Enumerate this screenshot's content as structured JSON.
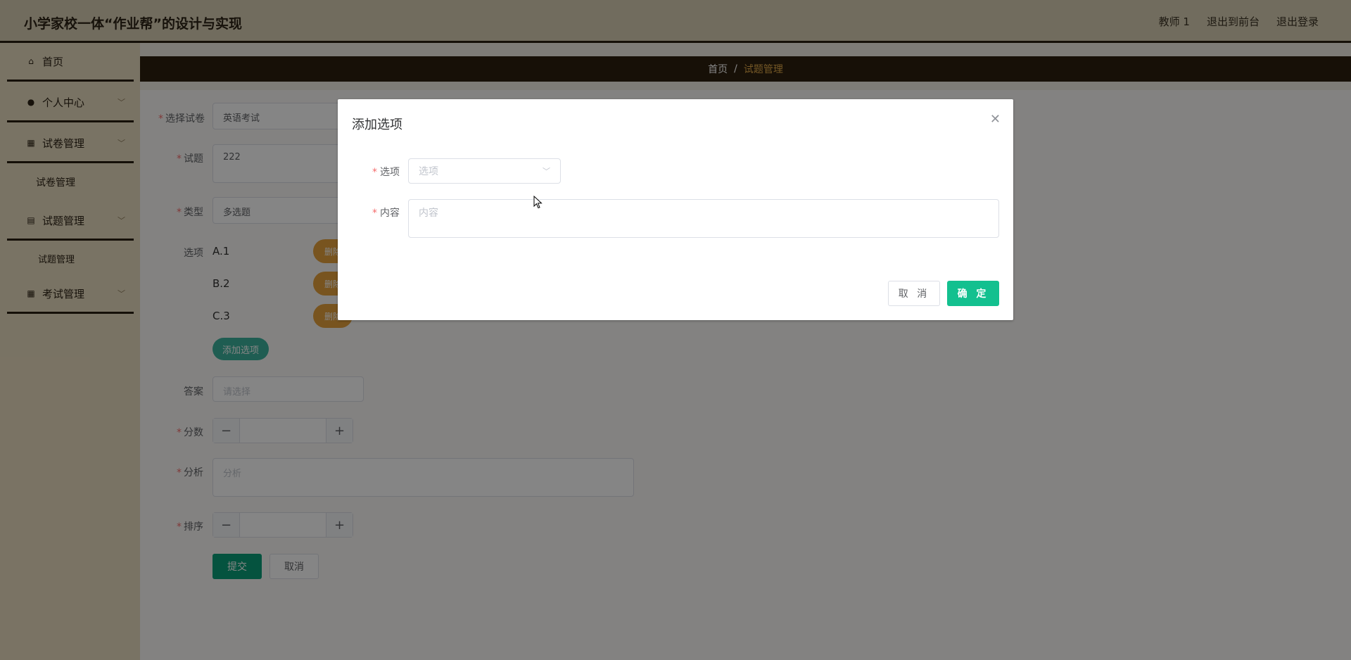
{
  "header": {
    "title": "小学家校一体“作业帮”的设计与实现",
    "links": [
      "教师 1",
      "退出到前台",
      "退出登录"
    ]
  },
  "sidebar": {
    "items": [
      {
        "label": "首页",
        "icon": "home-icon"
      },
      {
        "label": "个人中心",
        "icon": "user-icon"
      },
      {
        "label": "试卷管理",
        "icon": "grid-icon"
      },
      {
        "label": "试卷管理"
      },
      {
        "label": "试题管理",
        "icon": "clipboard-icon"
      },
      {
        "label": "试题管理"
      },
      {
        "label": "考试管理",
        "icon": "grid-icon"
      }
    ]
  },
  "breadcrumb": {
    "home": "首页",
    "separator": "/",
    "current": "试题管理"
  },
  "form": {
    "paper_label": "选择试卷",
    "paper_value": "英语考试",
    "question_label": "试题",
    "question_value": "222",
    "type_label": "类型",
    "type_value": "多选题",
    "options_label": "选项",
    "options": [
      "A.1",
      "B.2",
      "C.3"
    ],
    "delete_label": "删除",
    "add_option_label": "添加选项",
    "answer_label": "答案",
    "answer_placeholder": "请选择",
    "score_label": "分数",
    "analysis_label": "分析",
    "analysis_placeholder": "分析",
    "order_label": "排序",
    "submit_label": "提交",
    "cancel_label": "取消"
  },
  "dialog": {
    "title": "添加选项",
    "option_label": "选项",
    "option_placeholder": "选项",
    "content_label": "内容",
    "content_placeholder": "内容",
    "cancel_label": "取 消",
    "ok_label": "确 定"
  },
  "colors": {
    "header_bg": "#d9cfb5",
    "dark_brown": "#2d1f0e",
    "accent_gold": "#e0a94a",
    "primary_green": "#13c08f",
    "delete_orange": "#e6a23c"
  }
}
